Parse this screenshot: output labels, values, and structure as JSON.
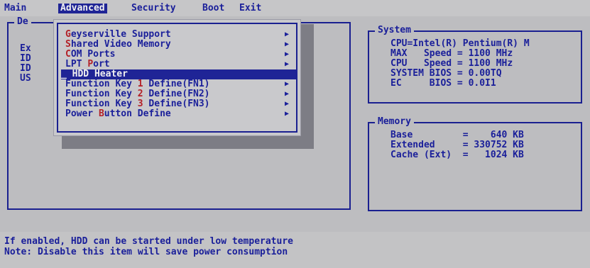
{
  "menu": {
    "items": [
      "Main",
      "Advanced",
      "Security",
      "Boot",
      "Exit"
    ],
    "active_index": 1
  },
  "left_panel": {
    "title_partial": "De",
    "rows": [
      "Ex",
      "ID",
      "ID",
      "US"
    ]
  },
  "popup": {
    "items": [
      {
        "hot": "G",
        "rest": "eyserville Support",
        "arrow": "▶"
      },
      {
        "hot": "S",
        "rest": "hared Video Memory",
        "arrow": "▶"
      },
      {
        "hot": "C",
        "rest": "OM Ports",
        "arrow": "▶"
      },
      {
        "pre": "LPT ",
        "hot": "P",
        "rest": "ort",
        "arrow": "▶"
      },
      {
        "pre": "_ ",
        "hot": "",
        "rest": "HDD Heater",
        "arrow": ""
      },
      {
        "pre": "Function Key ",
        "hot": "1",
        "rest": " Define(FN1)",
        "arrow": "▶"
      },
      {
        "pre": "Function Key ",
        "hot": "2",
        "rest": " Define(FN2)",
        "arrow": "▶"
      },
      {
        "pre": "Function Key ",
        "hot": "3",
        "rest": " Define(FN3)",
        "arrow": "▶"
      },
      {
        "pre": "Power ",
        "hot": "B",
        "rest": "utton Define",
        "arrow": "▶"
      }
    ],
    "selected_index": 4
  },
  "system": {
    "title": "System",
    "lines": [
      "CPU=Intel(R) Pentium(R) M",
      "MAX   Speed = 1100 MHz",
      "CPU   Speed = 1100 MHz",
      "SYSTEM BIOS = 0.00TQ",
      "EC     BIOS = 0.0I1"
    ]
  },
  "memory": {
    "title": "Memory",
    "lines": [
      "Base         =    640 KB",
      "Extended     = 330752 KB",
      "Cache (Ext)  =   1024 KB"
    ]
  },
  "help": {
    "line1": "If enabled, HDD can be started under low temperature",
    "line2": "Note: Disable this item will save power consumption"
  },
  "colors": {
    "background": "#bdbdc0",
    "text": "#1a1f9a",
    "highlight": "#1f2496",
    "hotkey": "#b31f26"
  }
}
